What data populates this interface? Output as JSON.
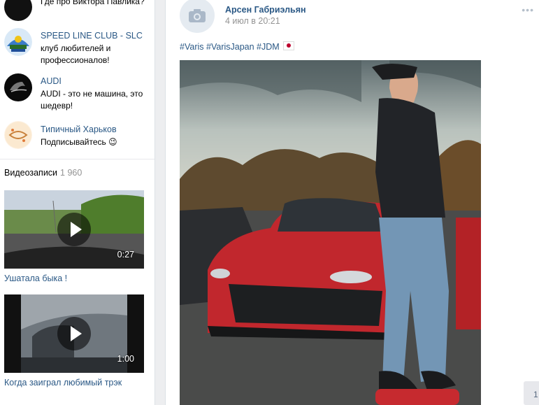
{
  "groups": [
    {
      "name": "",
      "desc": "Где про Виктора Павлика?"
    },
    {
      "name": "SPEED LINE CLUB - SLC",
      "desc": "клуб любителей и профессионалов!"
    },
    {
      "name": "AUDI",
      "desc": "AUDI - это не машина, это шедевр!"
    },
    {
      "name": "Типичный Харьков",
      "desc": "Подписывайтесь 😉"
    }
  ],
  "videos": {
    "header": "Видеозаписи",
    "count": "1 960",
    "items": [
      {
        "title": "Ушатала быка !",
        "duration": "0:27"
      },
      {
        "title": "Когда заиграл любимый трэк",
        "duration": "1:00"
      }
    ]
  },
  "post": {
    "author": "Арсен Габриэльян",
    "date": "4 июл в 20:21",
    "hashtags": [
      "#Varis",
      "#VarisJapan",
      "#JDM"
    ],
    "flag": "japan-flag",
    "menu": "•••"
  },
  "pagination": {
    "label": "1"
  },
  "colors": {
    "link": "#2a5885",
    "muted": "#939393",
    "page_bg": "#edeef0"
  }
}
